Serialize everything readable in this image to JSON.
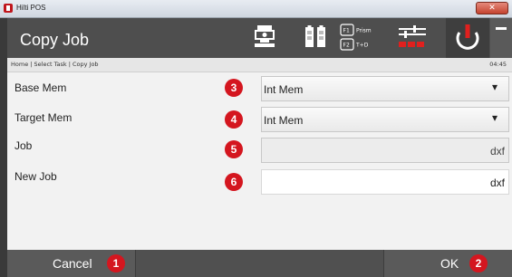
{
  "window": {
    "title": "Hilti POS",
    "close_glyph": "✕"
  },
  "header": {
    "title": "Copy Job",
    "icons": [
      "instrument-icon",
      "battery-icon",
      "function-keys-icon",
      "settings-icon",
      "power-icon",
      "minimize-icon"
    ],
    "f1_key": "F1",
    "f1_label": "Prism",
    "f2_key": "F2",
    "f2_label": "T+D"
  },
  "breadcrumb": "Home | Select Task | Copy Job",
  "clock": "04:45",
  "form": {
    "base_mem": {
      "label": "Base Mem",
      "marker": "3",
      "value": "Int Mem",
      "caret": "▾"
    },
    "target_mem": {
      "label": "Target Mem",
      "marker": "4",
      "value": "Int Mem",
      "caret": "▾"
    },
    "job": {
      "label": "Job",
      "marker": "5",
      "value": "dxf"
    },
    "new_job": {
      "label": "New Job",
      "marker": "6",
      "value": "dxf"
    }
  },
  "footer": {
    "cancel_label": "Cancel",
    "cancel_marker": "1",
    "ok_label": "OK",
    "ok_marker": "2"
  },
  "colors": {
    "accent_red": "#d4161f",
    "header_bg": "#4e4e4e",
    "power_icon": "#e0201e"
  }
}
